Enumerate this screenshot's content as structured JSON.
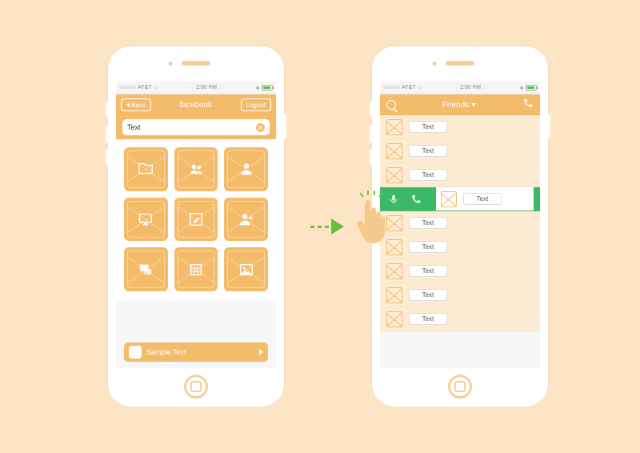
{
  "status": {
    "carrier": "AT&T",
    "time": "2:00 PM",
    "signal_prefix": "○○○○○"
  },
  "screen1": {
    "back_label": "Back",
    "title": "facebook",
    "logout_label": "Logout",
    "search_value": "Text",
    "grid_icons": [
      "folder",
      "group",
      "person",
      "airplay",
      "edit",
      "add-user",
      "chat",
      "grid",
      "picture"
    ],
    "bottom_label": "Sample Text"
  },
  "screen2": {
    "title": "Friends",
    "rows": [
      {
        "label": "Text",
        "swiped": false
      },
      {
        "label": "Text",
        "swiped": false
      },
      {
        "label": "Text",
        "swiped": false
      },
      {
        "label": "Text",
        "swiped": true
      },
      {
        "label": "Text",
        "swiped": false
      },
      {
        "label": "Text",
        "swiped": false
      },
      {
        "label": "Text",
        "swiped": false
      },
      {
        "label": "Text",
        "swiped": false
      },
      {
        "label": "Text",
        "swiped": false
      }
    ]
  },
  "colors": {
    "accent": "#f4bb6a",
    "swipe_action": "#3bb968",
    "arrow": "#6bbf3f",
    "bg": "#fce4c4"
  }
}
